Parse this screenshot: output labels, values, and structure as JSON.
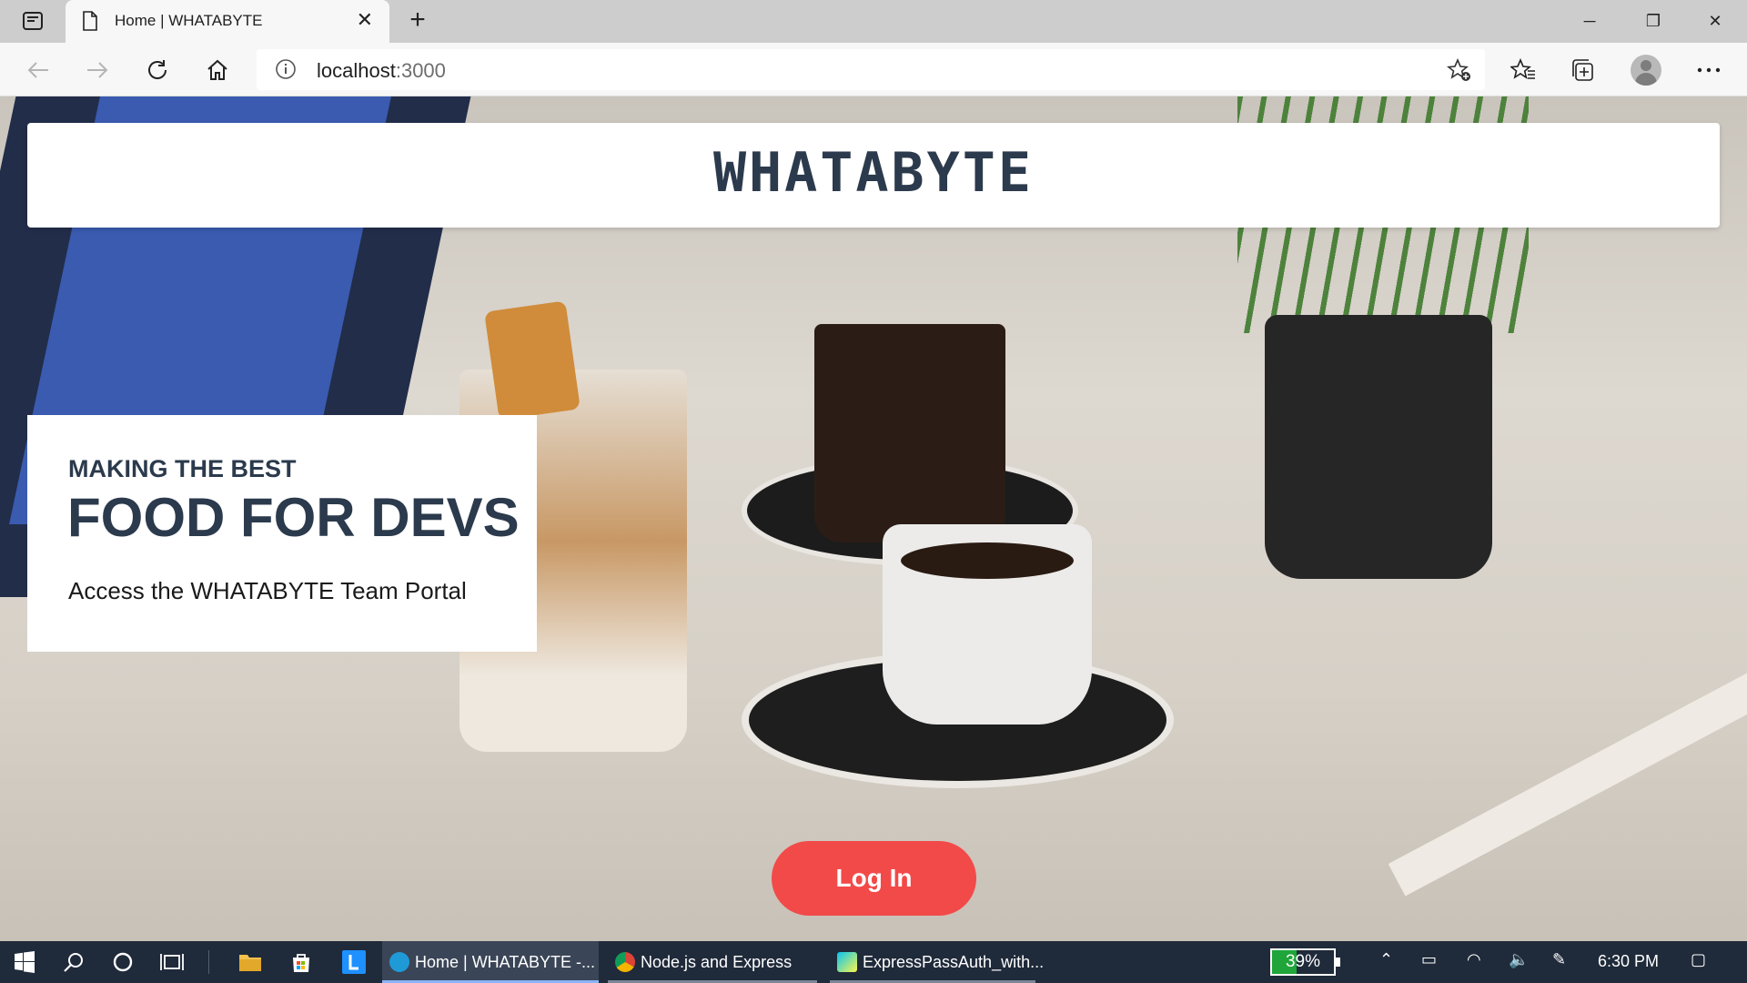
{
  "browser": {
    "tab_title": "Home | WHATABYTE",
    "url_host": "localhost",
    "url_port": ":3000"
  },
  "page": {
    "brand": "WHATABYTE",
    "hero_subtitle": "MAKING THE BEST",
    "hero_title": "FOOD FOR DEVS",
    "hero_description": "Access the WHATABYTE Team Portal",
    "login_label": "Log In",
    "accent_color": "#f24a49",
    "text_color": "#2b3a4c"
  },
  "taskbar": {
    "apps": [
      {
        "label": "Home | WHATABYTE -...",
        "icon": "edge-icon",
        "active": true
      },
      {
        "label": "Node.js and Express T...",
        "icon": "chrome-icon",
        "active": false
      },
      {
        "label": "ExpressPassAuth_with...",
        "icon": "webstorm-icon",
        "active": false
      }
    ],
    "battery_percent": "39%",
    "battery_level": 0.39,
    "clock": "6:30 PM"
  }
}
